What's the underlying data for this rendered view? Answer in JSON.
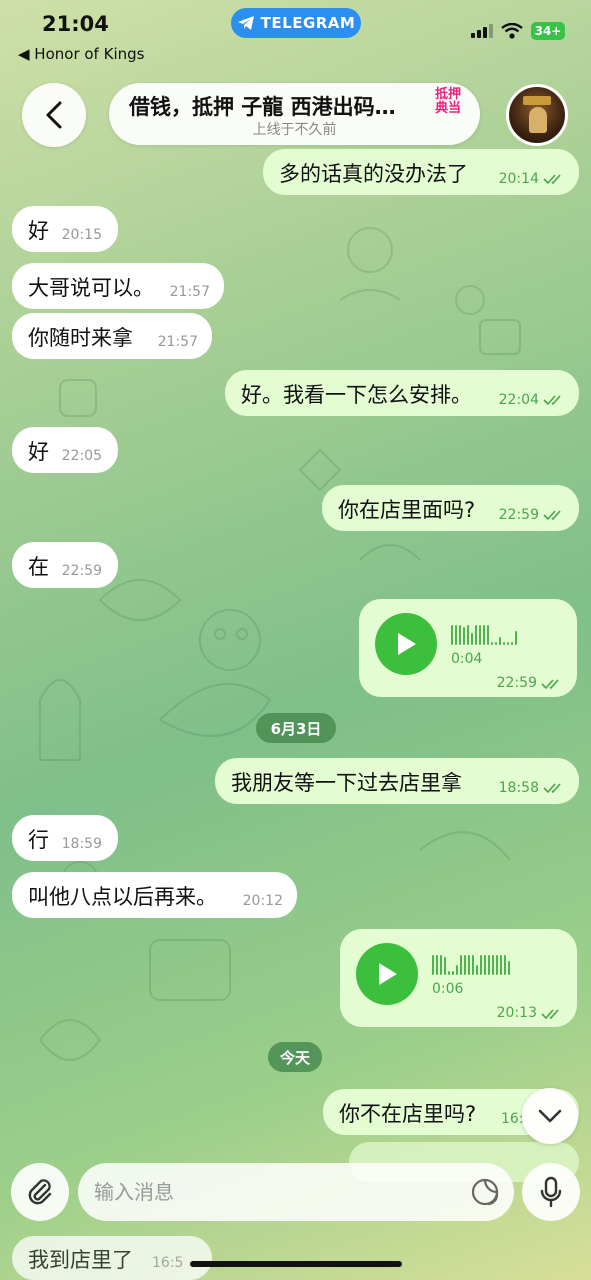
{
  "status_bar": {
    "time": "21:04",
    "back_app": "◀ Honor of Kings",
    "app_pill": "TELEGRAM",
    "battery": "34+"
  },
  "header": {
    "title": "借钱，抵押 子龍 西港出码…",
    "title_badge": "抵押典当",
    "subtitle": "上线于不久前"
  },
  "messages": [
    {
      "id": "m0",
      "dir": "out",
      "text": "多的话真的没办法了",
      "time": "20:14"
    },
    {
      "id": "m1",
      "dir": "in",
      "text": "好",
      "time": "20:15"
    },
    {
      "id": "m2",
      "dir": "in",
      "text": "大哥说可以。",
      "time": "21:57"
    },
    {
      "id": "m3",
      "dir": "in",
      "text": "你随时来拿",
      "time": "21:57"
    },
    {
      "id": "m4",
      "dir": "out",
      "text": "好。我看一下怎么安排。",
      "time": "22:04"
    },
    {
      "id": "m5",
      "dir": "in",
      "text": "好",
      "time": "22:05"
    },
    {
      "id": "m6",
      "dir": "out",
      "text": "你在店里面吗?",
      "time": "22:59"
    },
    {
      "id": "m7",
      "dir": "in",
      "text": "在",
      "time": "22:59"
    },
    {
      "id": "v1",
      "dir": "out",
      "type": "voice",
      "duration": "0:04",
      "time": "22:59"
    },
    {
      "id": "d1",
      "type": "date",
      "text": "6月3日"
    },
    {
      "id": "m8",
      "dir": "out",
      "text": "我朋友等一下过去店里拿",
      "time": "18:58"
    },
    {
      "id": "m9",
      "dir": "in",
      "text": "行",
      "time": "18:59"
    },
    {
      "id": "m10",
      "dir": "in",
      "text": "叫他八点以后再来。",
      "time": "20:12"
    },
    {
      "id": "v2",
      "dir": "out",
      "type": "voice",
      "duration": "0:06",
      "time": "20:13"
    },
    {
      "id": "d2",
      "type": "date",
      "text": "今天"
    },
    {
      "id": "m11",
      "dir": "out",
      "text": "你不在店里吗?",
      "time": "16:"
    },
    {
      "id": "m12",
      "dir": "in",
      "text": "我到店里了",
      "time": "16:5"
    }
  ],
  "composer": {
    "placeholder": "输入消息"
  },
  "colors": {
    "incoming_bubble": "#ffffff",
    "outgoing_bubble": "#e3fcd2",
    "accent_green": "#3cbf3c",
    "telegram_blue": "#2a8ff0"
  }
}
